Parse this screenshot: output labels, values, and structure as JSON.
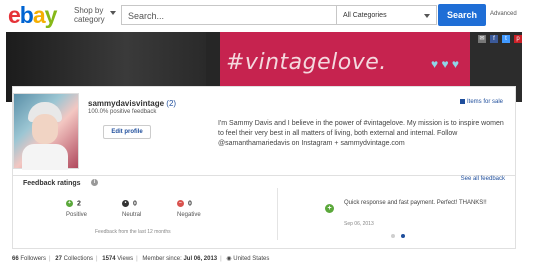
{
  "header": {
    "logo_letters": [
      {
        "char": "e",
        "color": "#e53238"
      },
      {
        "char": "b",
        "color": "#0064d2"
      },
      {
        "char": "a",
        "color": "#f5af02"
      },
      {
        "char": "y",
        "color": "#86b817"
      }
    ],
    "shop_by_line1": "Shop by",
    "shop_by_line2": "category",
    "search_placeholder": "Search...",
    "category_value": "All Categories",
    "search_button": "Search",
    "advanced_link": "Advanced"
  },
  "banner": {
    "hashtag": "#vintagelove.",
    "hearts": "♥ ♥ ♥",
    "social_icons": [
      "mail-icon",
      "facebook-icon",
      "twitter-icon",
      "pinterest-icon"
    ]
  },
  "profile": {
    "username": "sammydavisvintage",
    "feedback_count": "(2)",
    "positive_feedback": "100.0% positive feedback",
    "edit_button": "Edit profile",
    "items_for_sale": "Items for sale",
    "bio": "I'm Sammy Davis and I believe in the power of #vintagelove. My mission is to inspire women to feel their very best in all matters of living, both external and internal. Follow @samanthamariedavis on Instagram + sammydvintage.com"
  },
  "feedback": {
    "title": "Feedback ratings",
    "see_all": "See all feedback",
    "ratings": [
      {
        "count": "2",
        "label": "Positive",
        "color": "#5ba83b",
        "symbol": "+"
      },
      {
        "count": "0",
        "label": "Neutral",
        "color": "#333333",
        "symbol": "•"
      },
      {
        "count": "0",
        "label": "Negative",
        "color": "#d9534f",
        "symbol": "−"
      }
    ],
    "period": "Feedback from the last 12 months",
    "comment": "Quick response and fast payment. Perfect! THANKS!!",
    "comment_date": "Sep 06, 2013"
  },
  "stats": {
    "followers_count": "66",
    "followers_label": "Followers",
    "collections_count": "27",
    "collections_label": "Collections",
    "views_count": "1574",
    "views_label": "Views",
    "member_since_label": "Member since:",
    "member_since_date": "Jul 06, 2013",
    "location": "United States"
  }
}
